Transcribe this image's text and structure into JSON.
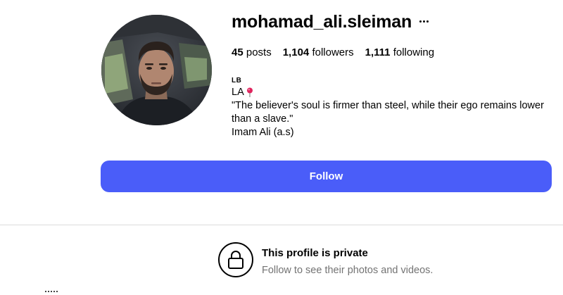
{
  "profile": {
    "username": "mohamad_ali.sleiman",
    "more_icon": "more-horizontal-icon",
    "avatar_icon": "profile-photo"
  },
  "stats": {
    "posts_count": "45",
    "posts_label": "posts",
    "followers_count": "1,104",
    "followers_label": "followers",
    "following_count": "1,111",
    "following_label": "following"
  },
  "bio": {
    "category": "LB",
    "location": "LA",
    "location_icon": "round-pushpin-icon",
    "quote": "\"The believer's soul is firmer than steel, while their ego remains lower than a slave.\"",
    "attribution": "Imam Ali (a.s)"
  },
  "actions": {
    "follow_label": "Follow",
    "follow_color": "#4a5df9"
  },
  "private_notice": {
    "icon": "lock-icon",
    "title": "This profile is private",
    "subtitle": "Follow to see their photos and videos."
  }
}
